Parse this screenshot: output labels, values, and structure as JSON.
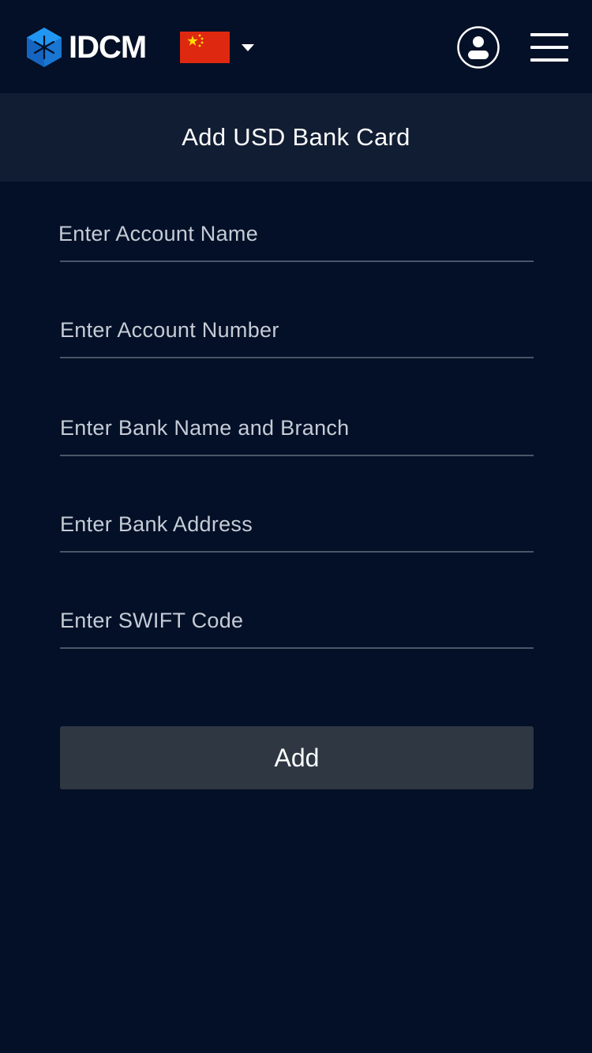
{
  "header": {
    "brand": "IDCM",
    "language": {
      "flag_icon": "china-flag-icon",
      "caret_icon": "caret-down-icon"
    },
    "user_icon": "user-account-icon",
    "menu_icon": "hamburger-menu-icon"
  },
  "page": {
    "title": "Add USD Bank Card"
  },
  "form": {
    "account_name": {
      "placeholder": "Enter Account Name",
      "value": ""
    },
    "account_number": {
      "placeholder": "Enter Account Number",
      "value": ""
    },
    "bank_name_branch": {
      "placeholder": "Enter Bank Name and Branch",
      "value": ""
    },
    "bank_address": {
      "placeholder": "Enter Bank Address",
      "value": ""
    },
    "swift_code": {
      "placeholder": "Enter SWIFT Code",
      "value": ""
    },
    "submit_label": "Add"
  },
  "colors": {
    "background": "#031027",
    "title_bar": "#111d33",
    "button": "#2e3742",
    "brand_blue": "#1e88e5",
    "flag_red": "#de2910",
    "flag_yellow": "#ffde00"
  }
}
